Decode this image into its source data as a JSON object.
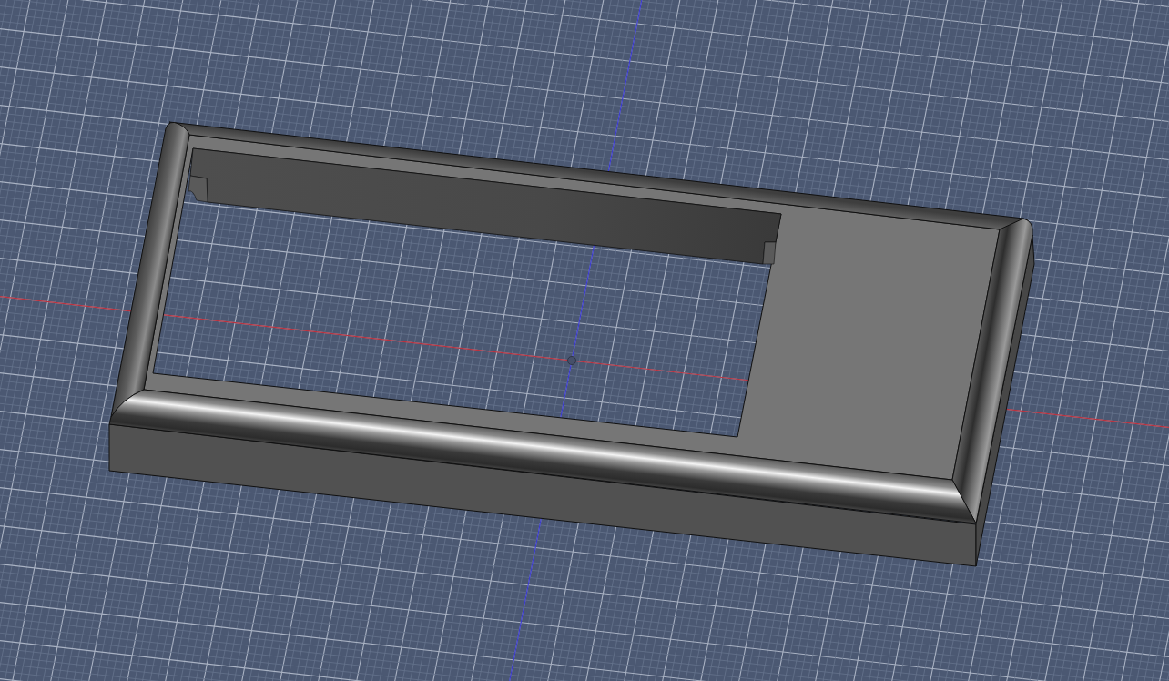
{
  "viewport": {
    "grid": {
      "visible": true
    },
    "axes": [
      {
        "kind": "x",
        "color": "#b8323f"
      },
      {
        "kind": "y",
        "color": "#3a3acc"
      }
    ]
  }
}
